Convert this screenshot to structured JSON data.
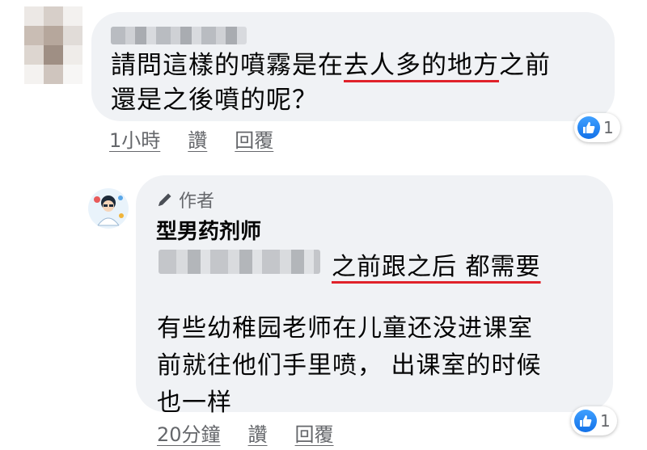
{
  "comment": {
    "text_before": "請問這樣的噴霧是在",
    "text_highlight": "去人多的地方",
    "text_after": "之前",
    "text_line2": "還是之後噴的呢？",
    "time": "1小時",
    "like_label": "讚",
    "reply_label": "回覆",
    "reaction_count": "1"
  },
  "reply": {
    "author_badge": "作者",
    "author_name": "型男药剂师",
    "highlight": "之前跟之后 都需要",
    "body_line1": "有些幼稚园老师在儿童还没进课室",
    "body_line2": "前就往他们手里喷， 出课室的时候",
    "body_line3": "也一样",
    "time": "20分鐘",
    "like_label": "讚",
    "reply_label": "回覆",
    "reaction_count": "1"
  },
  "colors": {
    "bubble": "#f0f2f5",
    "underline": "#e0222a",
    "meta_text": "#65676b",
    "like_blue": "#1877f2"
  },
  "icons": [
    "like-icon",
    "pencil-icon"
  ]
}
